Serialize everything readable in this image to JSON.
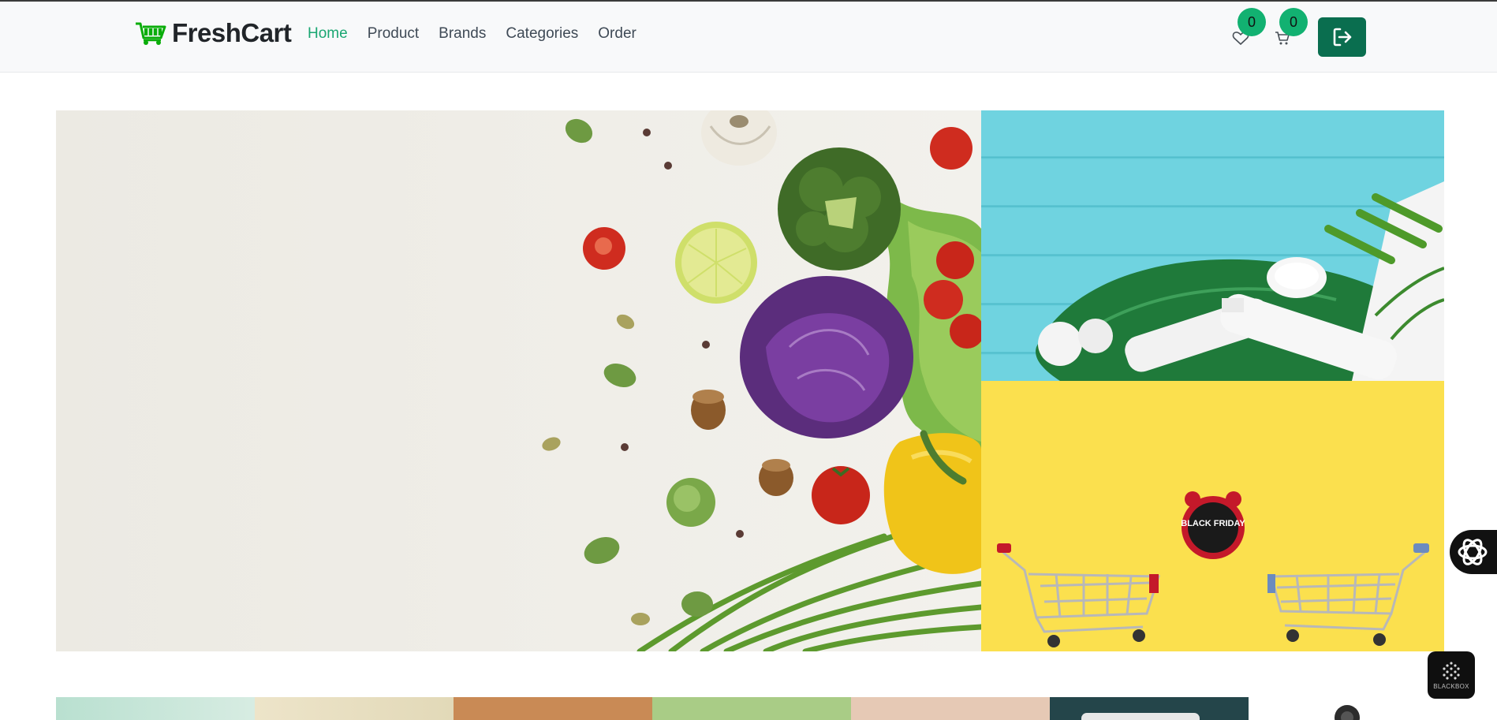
{
  "brand": {
    "name": "FreshCart",
    "color": "#1aa772"
  },
  "nav": {
    "links": [
      {
        "label": "Home",
        "active": true
      },
      {
        "label": "Product",
        "active": false
      },
      {
        "label": "Brands",
        "active": false
      },
      {
        "label": "Categories",
        "active": false
      },
      {
        "label": "Order",
        "active": false
      }
    ]
  },
  "header_actions": {
    "wishlist": {
      "icon": "heart-icon",
      "count": "0"
    },
    "cart": {
      "icon": "cart-icon",
      "count": "0"
    },
    "logout": {
      "icon": "sign-out-icon",
      "color": "#0a6e4f"
    },
    "badge_color": "#12b171"
  },
  "hero": {
    "main_image": "vegetables-photo",
    "side_top_image": "cosmetics-photo",
    "side_bottom_image": "black-friday-carts-photo",
    "clock_text": "BLACK FRIDAY"
  },
  "floating": {
    "assistant_icon": "openai-icon",
    "blackbox_label": "BLACKBOX"
  }
}
